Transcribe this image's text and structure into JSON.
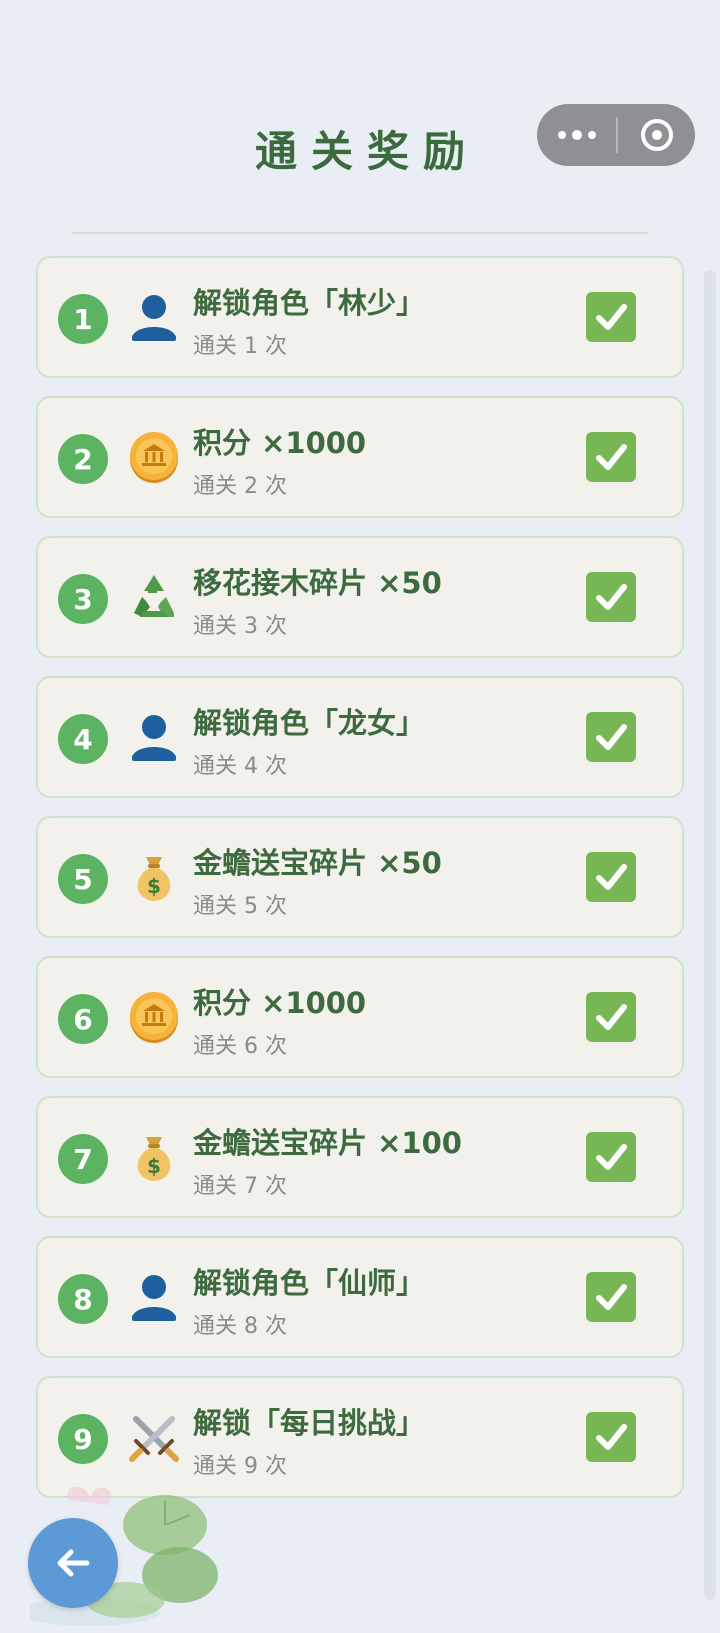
{
  "header": {
    "title": "通关奖励"
  },
  "rewards": [
    {
      "num": "1",
      "icon": "person-silhouette-icon",
      "name": "解锁角色「林少」",
      "sub": "通关 1 次",
      "claimed": true
    },
    {
      "num": "2",
      "icon": "coin-icon",
      "name": "积分 ×1000",
      "sub": "通关 2 次",
      "claimed": true
    },
    {
      "num": "3",
      "icon": "recycle-icon",
      "name": "移花接木碎片 ×50",
      "sub": "通关 3 次",
      "claimed": true
    },
    {
      "num": "4",
      "icon": "person-silhouette-icon",
      "name": "解锁角色「龙女」",
      "sub": "通关 4 次",
      "claimed": true
    },
    {
      "num": "5",
      "icon": "money-bag-icon",
      "name": "金蟾送宝碎片 ×50",
      "sub": "通关 5 次",
      "claimed": true
    },
    {
      "num": "6",
      "icon": "coin-icon",
      "name": "积分 ×1000",
      "sub": "通关 6 次",
      "claimed": true
    },
    {
      "num": "7",
      "icon": "money-bag-icon",
      "name": "金蟾送宝碎片 ×100",
      "sub": "通关 7 次",
      "claimed": true
    },
    {
      "num": "8",
      "icon": "person-silhouette-icon",
      "name": "解锁角色「仙师」",
      "sub": "通关 8 次",
      "claimed": true
    },
    {
      "num": "9",
      "icon": "crossed-swords-icon",
      "name": "解锁「每日挑战」",
      "sub": "通关 9 次",
      "claimed": true
    }
  ],
  "colors": {
    "accent_green": "#5cb463",
    "title_green": "#3b6b3d",
    "check_green": "#77b655",
    "back_button_blue": "#5b9ad6"
  }
}
